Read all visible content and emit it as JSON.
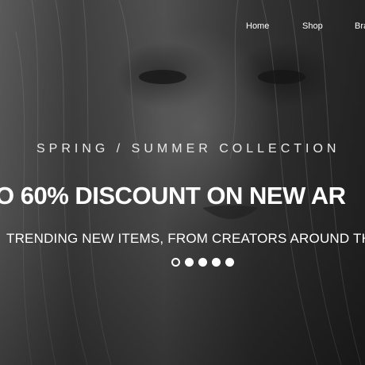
{
  "nav": {
    "items": [
      {
        "label": "Home"
      },
      {
        "label": "Shop"
      },
      {
        "label": "Bra"
      }
    ]
  },
  "slider": {
    "kicker": "SPRING / SUMMER COLLECTION",
    "headline": "O 60% DISCOUNT ON NEW AR",
    "subline": "TRENDING NEW ITEMS, FROM CREATORS AROUND THE W",
    "active_slide": 1,
    "slide_count": 5
  },
  "colors": {
    "text": "#ffffff",
    "background": "#3c3c3c"
  }
}
